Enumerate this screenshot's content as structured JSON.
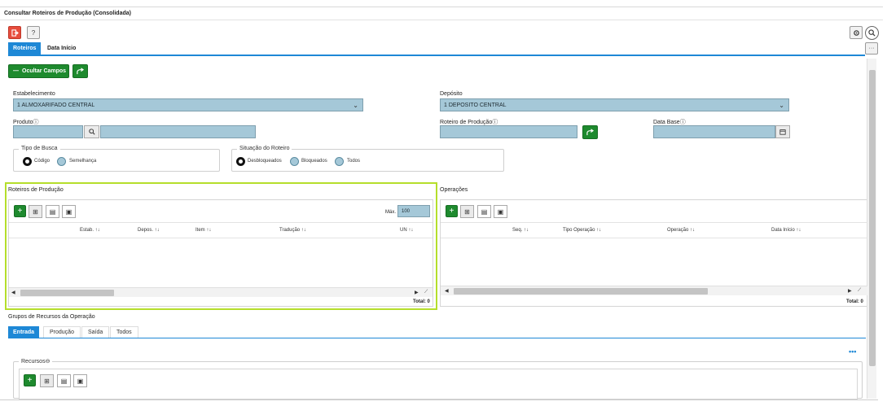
{
  "window": {
    "title": "Consultar Roteiros de Produção (Consolidada)"
  },
  "toolbar": {
    "exit_icon": "exit-icon",
    "help_label": "?",
    "settings_icon": "gear-icon",
    "search_icon": "search-icon",
    "more_label": "···"
  },
  "tabs": [
    {
      "label": "Roteiros",
      "active": true
    },
    {
      "label": "Data Início",
      "active": false
    }
  ],
  "actions": {
    "hide_fields_label": "Ocultar Campos",
    "hide_fields_icon": "minus-icon",
    "share_icon": "share-arrow-icon"
  },
  "form": {
    "estabelecimento": {
      "label": "Estabelecimento",
      "value": "1 ALMOXARIFADO CENTRAL"
    },
    "deposito": {
      "label": "Depósito",
      "value": "1 DEPOSITO CENTRAL"
    },
    "produto": {
      "label": "Produto",
      "code": "",
      "description": ""
    },
    "roteiro": {
      "label": "Roteiro de Produção",
      "value": ""
    },
    "data_base": {
      "label": "Data Base",
      "value": ""
    },
    "tipo_busca": {
      "title": "Tipo de Busca",
      "options": [
        "Código",
        "Semelhança"
      ],
      "selected": "Código"
    },
    "situacao": {
      "title": "Situação do Roteiro",
      "options": [
        "Desbloqueados",
        "Bloqueados",
        "Todos"
      ],
      "selected": "Desbloqueados"
    }
  },
  "roteiros_grid": {
    "title": "Roteiros de Produção",
    "max_label": "Máx.",
    "max_value": "100",
    "columns": [
      "Estab. ↑↓",
      "Depos. ↑↓",
      "Item ↑↓",
      "Tradução ↑↓",
      "UN ↑↓"
    ],
    "total": "Total: 0"
  },
  "operacoes_grid": {
    "title": "Operações",
    "columns": [
      "Seq. ↑↓",
      "Tipo Operação ↑↓",
      "Operação ↑↓",
      "Data Início ↑↓"
    ],
    "total": "Total: 0"
  },
  "grupos": {
    "title": "Grupos de Recursos da Operação",
    "tabs": [
      {
        "label": "Entrada",
        "active": true
      },
      {
        "label": "Produção",
        "active": false
      },
      {
        "label": "Saída",
        "active": false
      },
      {
        "label": "Todos",
        "active": false
      }
    ],
    "more_label": "•••",
    "recursos_title": "Recursos"
  },
  "colors": {
    "accent": "#1e88d6",
    "green": "#1e8a2e",
    "field": "#a5c8d8",
    "highlight": "#b5de2b",
    "danger": "#e74c3c"
  }
}
